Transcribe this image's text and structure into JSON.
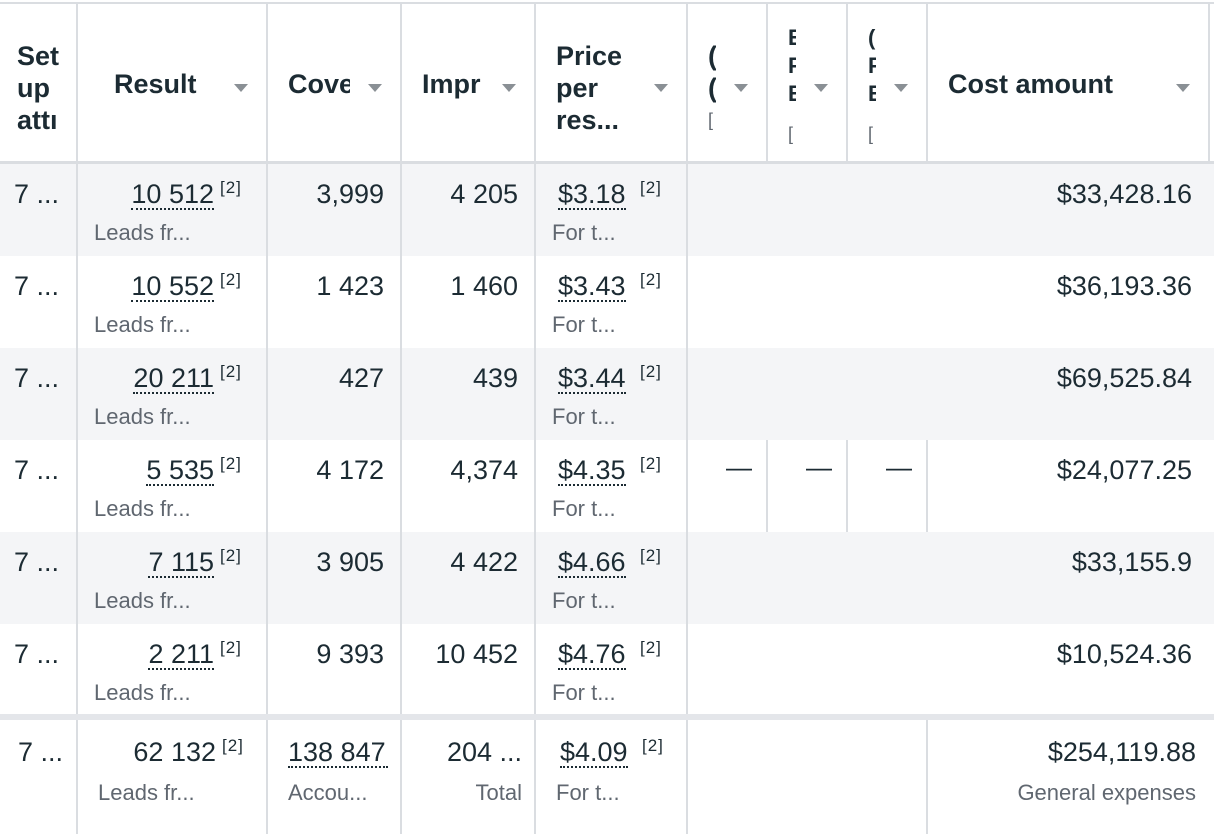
{
  "columns": [
    {
      "label": "Set up attr",
      "lines": [
        "Set",
        "up",
        "attı"
      ]
    },
    {
      "label": "Result"
    },
    {
      "label": "Cove"
    },
    {
      "label": "Impr"
    },
    {
      "label": "Price per res...",
      "lines": [
        "Price",
        "per",
        "res..."
      ]
    },
    {
      "label": "C",
      "lines": [
        "(",
        "(",
        "["
      ]
    },
    {
      "label": "E",
      "lines": [
        "E",
        "F",
        "E",
        "["
      ]
    },
    {
      "label": "C",
      "lines": [
        "(",
        "F",
        "E",
        "["
      ]
    },
    {
      "label": "Cost amount"
    }
  ],
  "rows": [
    {
      "setup": "7 ...",
      "result": "10 512",
      "result_ref": "[2]",
      "result_sub": "Leads fr...",
      "coverage": "3,999",
      "impressions": "4 205",
      "price": "$3.18",
      "price_ref": "[2]",
      "price_sub": "For t...",
      "c1": "",
      "c2": "",
      "c3": "",
      "cost": "$33,428.16"
    },
    {
      "setup": "7 ...",
      "result": "10 552",
      "result_ref": "[2]",
      "result_sub": "Leads fr...",
      "coverage": "1 423",
      "impressions": "1 460",
      "price": "$3.43",
      "price_ref": "[2]",
      "price_sub": "For t...",
      "c1": "",
      "c2": "",
      "c3": "",
      "cost": "$36,193.36"
    },
    {
      "setup": "7 ...",
      "result": "20 211",
      "result_ref": "[2]",
      "result_sub": "Leads fr...",
      "coverage": "427",
      "impressions": "439",
      "price": "$3.44",
      "price_ref": "[2]",
      "price_sub": "For t...",
      "c1": "",
      "c2": "",
      "c3": "",
      "cost": "$69,525.84"
    },
    {
      "setup": "7 ...",
      "result": "5 535",
      "result_ref": "[2]",
      "result_sub": "Leads fr...",
      "coverage": "4 172",
      "impressions": "4,374",
      "price": "$4.35",
      "price_ref": "[2]",
      "price_sub": "For t...",
      "c1": "—",
      "c2": "—",
      "c3": "—",
      "cost": "$24,077.25"
    },
    {
      "setup": "7 ...",
      "result": "7 115",
      "result_ref": "[2]",
      "result_sub": "Leads fr...",
      "coverage": "3 905",
      "impressions": "4 422",
      "price": "$4.66",
      "price_ref": "[2]",
      "price_sub": "For t...",
      "c1": "",
      "c2": "",
      "c3": "",
      "cost": "$33,155.9"
    },
    {
      "setup": "7 ...",
      "result": "2 211",
      "result_ref": "[2]",
      "result_sub": "Leads fr...",
      "coverage": "9 393",
      "impressions": "10 452",
      "price": "$4.76",
      "price_ref": "[2]",
      "price_sub": "For t...",
      "c1": "",
      "c2": "",
      "c3": "",
      "cost": "$10,524.36"
    }
  ],
  "footer": {
    "setup": "7 ...",
    "result": "62 132",
    "result_ref": "[2]",
    "result_sub": "Leads fr...",
    "coverage": "138 847",
    "coverage_sub": "Accou...",
    "impressions": "204 ...",
    "impressions_sub": "Total",
    "price": "$4.09",
    "price_ref": "[2]",
    "price_sub": "For t...",
    "cost": "$254,119.88",
    "cost_sub": "General expenses"
  },
  "colors": {
    "text": "#1c2b33",
    "muted": "#606770",
    "border": "#dadde1",
    "alt_row": "#f4f5f7"
  }
}
